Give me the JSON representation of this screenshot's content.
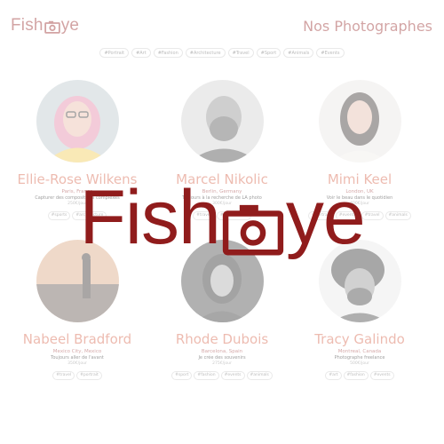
{
  "header": {
    "logo_prefix": "Fish",
    "logo_suffix": "ye",
    "logo_icon": "camera-icon",
    "title": "Nos Photographes"
  },
  "filters": [
    "#Portrait",
    "#Art",
    "#Fashion",
    "#Architecture",
    "#Travel",
    "#Sport",
    "#Animals",
    "#Events"
  ],
  "photographers": [
    {
      "name": "Ellie-Rose Wilkens",
      "location": "Paris, France",
      "tagline": "Capturer des compositions complexes",
      "price": "250€/jour",
      "tags": [
        "#sports",
        "#architecture"
      ]
    },
    {
      "name": "Marcel Nikolic",
      "location": "Berlin, Germany",
      "tagline": "Toujours à la recherche de LA photo",
      "price": "300€/jour",
      "tags": [
        "#travel",
        "#architecture"
      ]
    },
    {
      "name": "Mimi Keel",
      "location": "London, UK",
      "tagline": "Voir le beau dans le quotidien",
      "price": "400€/jour",
      "tags": [
        "#portrait",
        "#events",
        "#travel",
        "#animals"
      ]
    },
    {
      "name": "Nabeel Bradford",
      "location": "Mexico City, Mexico",
      "tagline": "Toujours aller de l'avant",
      "price": "350€/jour",
      "tags": [
        "#travel",
        "#portrait"
      ]
    },
    {
      "name": "Rhode Dubois",
      "location": "Barcelona, Spain",
      "tagline": "Je crée des souvenirs",
      "price": "275€/jour",
      "tags": [
        "#sport",
        "#fashion",
        "#events",
        "#animals"
      ]
    },
    {
      "name": "Tracy Galindo",
      "location": "Montreal, Canada",
      "tagline": "Photographe freelance",
      "price": "500€/jour",
      "tags": [
        "#art",
        "#fashion",
        "#events"
      ]
    }
  ],
  "overlay": {
    "prefix": "Fish",
    "suffix": "ye"
  },
  "colors": {
    "primary": "#901c1c",
    "secondary": "#d3573c"
  }
}
